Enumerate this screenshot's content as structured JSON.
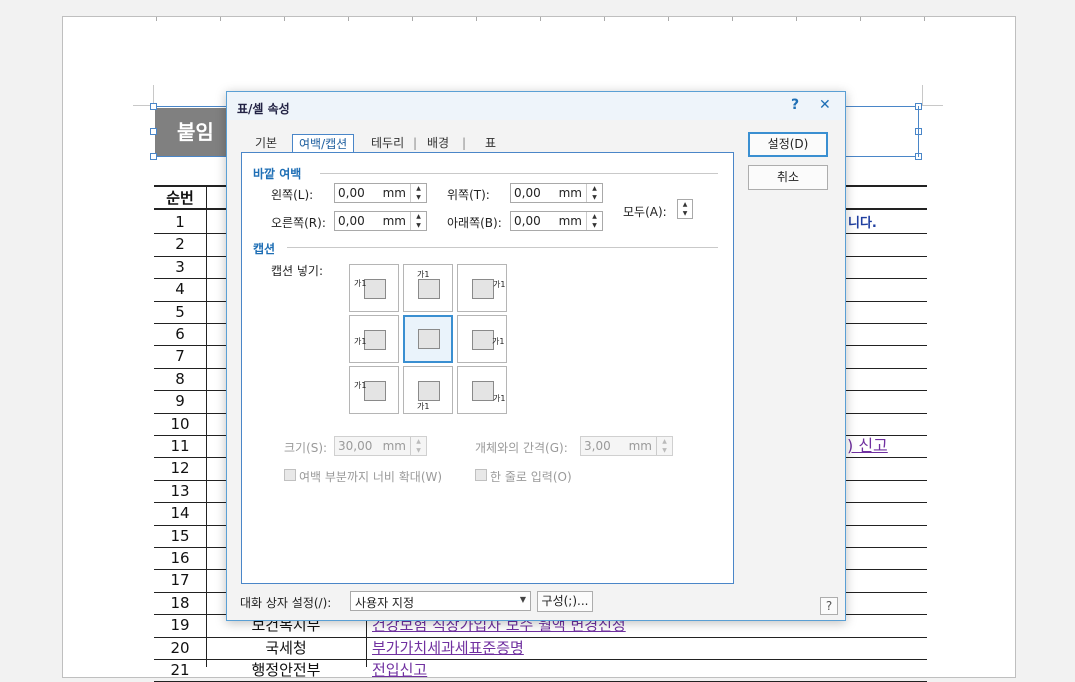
{
  "document": {
    "title": "붙임",
    "header_num": "순번",
    "rows": [
      {
        "num": "1",
        "org": "",
        "text": ""
      },
      {
        "num": "2",
        "org": "",
        "text": ""
      },
      {
        "num": "3",
        "org": "",
        "text": ""
      },
      {
        "num": "4",
        "org": "",
        "text": ""
      },
      {
        "num": "5",
        "org": "",
        "text": ""
      },
      {
        "num": "6",
        "org": "",
        "text": ""
      },
      {
        "num": "7",
        "org": "",
        "text": ""
      },
      {
        "num": "8",
        "org": "",
        "text": ""
      },
      {
        "num": "9",
        "org": "",
        "text": ""
      },
      {
        "num": "10",
        "org": "",
        "text": ""
      },
      {
        "num": "11",
        "org": "",
        "text": ""
      },
      {
        "num": "12",
        "org": "",
        "text": ""
      },
      {
        "num": "13",
        "org": "",
        "text": ""
      },
      {
        "num": "14",
        "org": "",
        "text": ""
      },
      {
        "num": "15",
        "org": "",
        "text": ""
      },
      {
        "num": "16",
        "org": "",
        "text": ""
      },
      {
        "num": "17",
        "org": "",
        "text": ""
      },
      {
        "num": "18",
        "org": "",
        "text": ""
      },
      {
        "num": "19",
        "org": "보건복지부",
        "text": "건강보험 직장가입자 보수 월액 변경신청"
      },
      {
        "num": "20",
        "org": "국세청",
        "text": "부가가치세과세표준증명"
      },
      {
        "num": "21",
        "org": "행정안전부",
        "text": "전입신고"
      }
    ],
    "peek_row1": "니다.",
    "peek_row11": ") 신고"
  },
  "dialog": {
    "title": "표/셀 속성",
    "help_glyph": "?",
    "close_glyph": "✕",
    "tabs": [
      "기본",
      "여백/캡션",
      "테두리",
      "배경",
      "표"
    ],
    "tab_separator": "|",
    "outer_margin": {
      "heading": "바깥 여백",
      "left_label": "왼쪽(L):",
      "left_value": "0,00",
      "top_label": "위쪽(T):",
      "top_value": "0,00",
      "right_label": "오른쪽(R):",
      "right_value": "0,00",
      "bottom_label": "아래쪽(B):",
      "bottom_value": "0,00",
      "all_label": "모두(A):",
      "unit": "mm"
    },
    "caption": {
      "heading": "캡션",
      "insert_label": "캡션 넣기:",
      "glyph": "가1",
      "size_label": "크기(S):",
      "size_value": "30,00",
      "gap_label": "개체와의 간격(G):",
      "gap_value": "3,00",
      "expand_label": "여백 부분까지 너비 확대(W)",
      "single_line_label": "한 줄로 입력(O)"
    },
    "buttons": {
      "ok": "설정(D)",
      "cancel": "취소",
      "config": "구성(;)..."
    },
    "footer": {
      "label": "대화 상자 설정(/):",
      "combo_value": "사용자 지정",
      "help": "?"
    }
  },
  "colors": {
    "accent": "#1f6fb5",
    "link": "#7030a0",
    "title_bg": "#808080"
  }
}
